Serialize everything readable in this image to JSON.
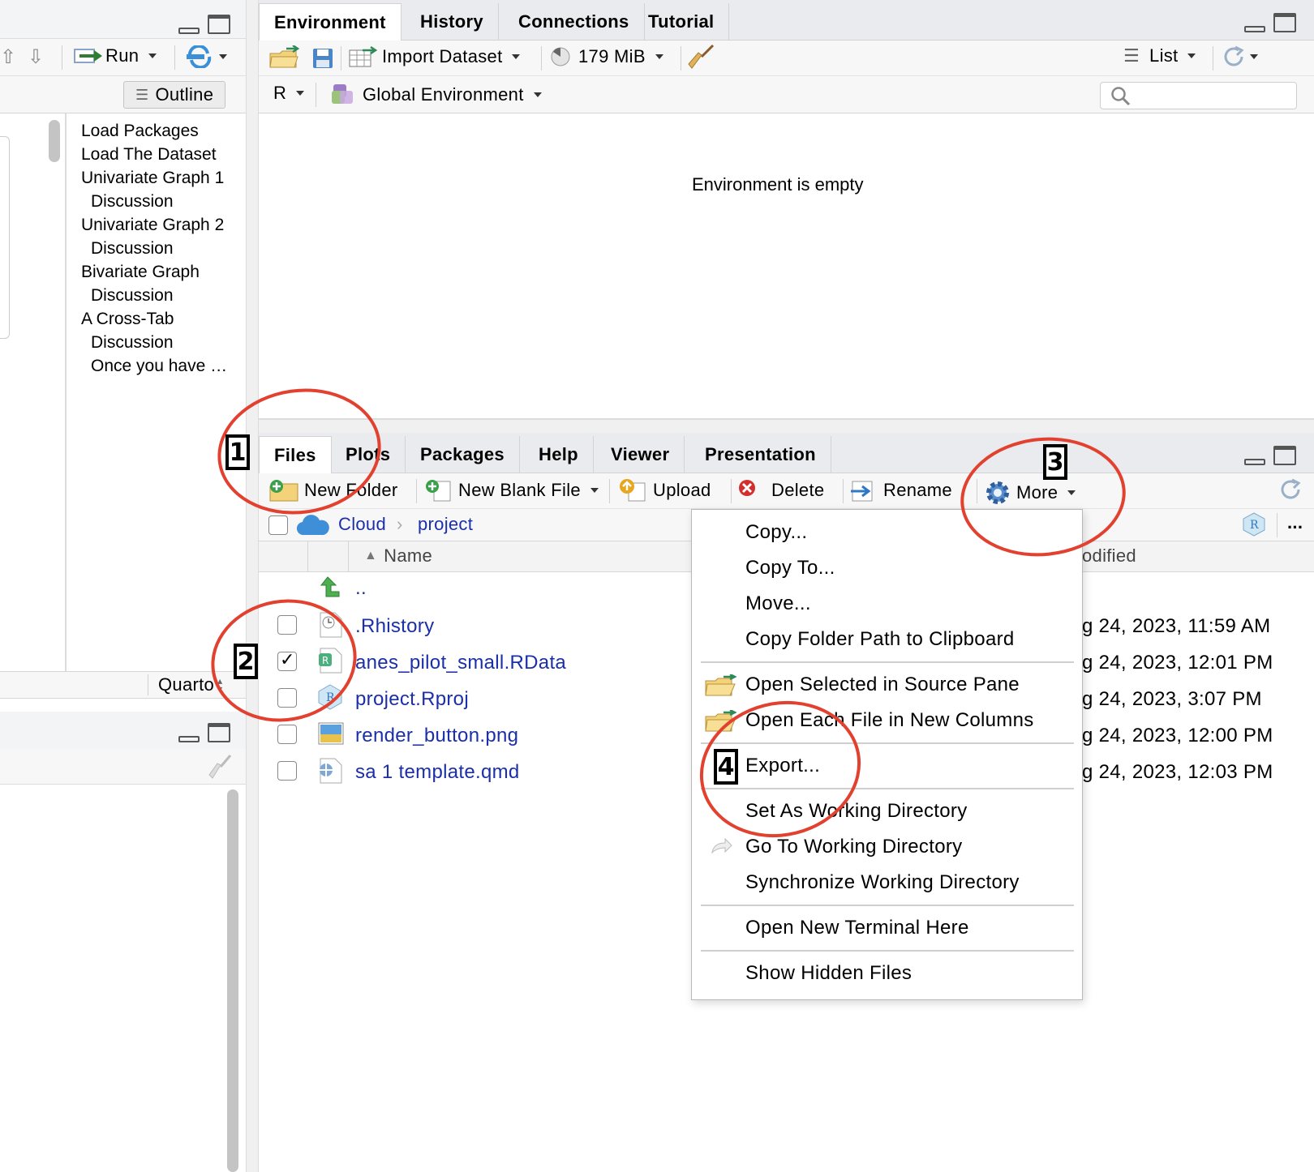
{
  "source_pane": {
    "toolbar": {
      "run_label": "Run"
    },
    "outline_button": "Outline",
    "outline_items": [
      "Load Packages",
      "Load The Dataset",
      "Univariate Graph 1",
      "Discussion",
      "Univariate Graph 2",
      "Discussion",
      "Bivariate Graph",
      "Discussion",
      "A Cross-Tab",
      "Discussion",
      "Once you have …"
    ],
    "doc_type": "Quarto"
  },
  "env_pane": {
    "tabs": [
      "Environment",
      "History",
      "Connections",
      "Tutorial"
    ],
    "import_dataset": "Import Dataset",
    "memory": "179 MiB",
    "view_mode": "List",
    "language": "R",
    "scope": "Global Environment",
    "empty_message": "Environment is empty"
  },
  "files_pane": {
    "tabs": [
      "Files",
      "Plots",
      "Packages",
      "Help",
      "Viewer",
      "Presentation"
    ],
    "toolbar": {
      "new_folder": "New Folder",
      "new_blank_file": "New Blank File",
      "upload": "Upload",
      "delete": "Delete",
      "rename": "Rename",
      "more": "More"
    },
    "breadcrumb": [
      "Cloud",
      "project"
    ],
    "ellipsis": "...",
    "columns": {
      "name": "Name",
      "modified": "odified"
    },
    "parent_dir": "..",
    "files": [
      {
        "name": ".Rhistory",
        "modified": "g 24, 2023, 11:59 AM",
        "checked": false
      },
      {
        "name": "anes_pilot_small.RData",
        "modified": "g 24, 2023, 12:01 PM",
        "checked": true
      },
      {
        "name": "project.Rproj",
        "modified": "g 24, 2023, 3:07 PM",
        "checked": false
      },
      {
        "name": "render_button.png",
        "modified": "g 24, 2023, 12:00 PM",
        "checked": false
      },
      {
        "name": "sa 1 template.qmd",
        "modified": "g 24, 2023, 12:03 PM",
        "checked": false
      }
    ]
  },
  "more_menu": {
    "items": [
      "Copy...",
      "Copy To...",
      "Move...",
      "Copy Folder Path to Clipboard",
      "Open Selected in Source Pane",
      "Open Each File in New Columns",
      "Export...",
      "Set As Working Directory",
      "Go To Working Directory",
      "Synchronize Working Directory",
      "Open New Terminal Here",
      "Show Hidden Files"
    ]
  },
  "annotations": {
    "labels": [
      "1",
      "2",
      "3",
      "4"
    ],
    "ring_color": "#e2412f"
  }
}
